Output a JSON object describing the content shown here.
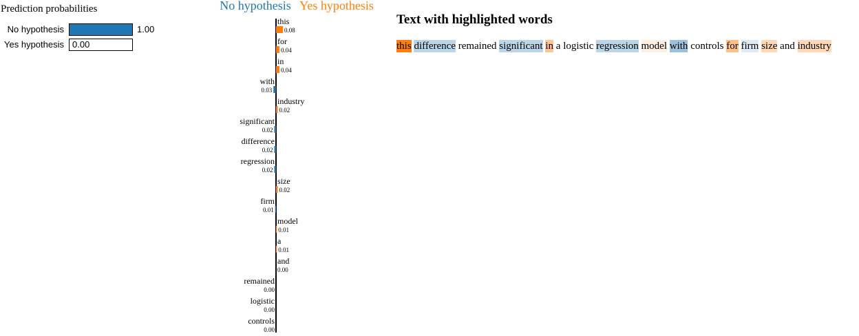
{
  "prediction": {
    "title": "Prediction probabilities",
    "classes": [
      {
        "label": "No hypothesis",
        "value": 1.0,
        "text": "1.00",
        "color": "#1f77b4"
      },
      {
        "label": "Yes hypothesis",
        "value": 0.0,
        "text": "0.00",
        "color": "#ff7f0e"
      }
    ]
  },
  "chart_data": {
    "type": "bar",
    "orientation": "horizontal",
    "negative_class": "No hypothesis",
    "positive_class": "Yes hypothesis",
    "negative_color": "#1f77b4",
    "positive_color": "#ff7f0e",
    "features": [
      {
        "word": "this",
        "weight": 0.08,
        "label": "0.08",
        "class": "Yes hypothesis"
      },
      {
        "word": "for",
        "weight": 0.04,
        "label": "0.04",
        "class": "Yes hypothesis"
      },
      {
        "word": "in",
        "weight": 0.04,
        "label": "0.04",
        "class": "Yes hypothesis"
      },
      {
        "word": "with",
        "weight": 0.03,
        "label": "0.03",
        "class": "No hypothesis"
      },
      {
        "word": "industry",
        "weight": 0.02,
        "label": "0.02",
        "class": "Yes hypothesis"
      },
      {
        "word": "significant",
        "weight": 0.02,
        "label": "0.02",
        "class": "No hypothesis"
      },
      {
        "word": "difference",
        "weight": 0.02,
        "label": "0.02",
        "class": "No hypothesis"
      },
      {
        "word": "regression",
        "weight": 0.02,
        "label": "0.02",
        "class": "No hypothesis"
      },
      {
        "word": "size",
        "weight": 0.02,
        "label": "0.02",
        "class": "Yes hypothesis"
      },
      {
        "word": "firm",
        "weight": 0.01,
        "label": "0.01",
        "class": "No hypothesis"
      },
      {
        "word": "model",
        "weight": 0.01,
        "label": "0.01",
        "class": "Yes hypothesis"
      },
      {
        "word": "a",
        "weight": 0.01,
        "label": "0.01",
        "class": "Yes hypothesis"
      },
      {
        "word": "and",
        "weight": 0.0,
        "label": "0.00",
        "class": "Yes hypothesis"
      },
      {
        "word": "remained",
        "weight": 0.0,
        "label": "0.00",
        "class": "No hypothesis"
      },
      {
        "word": "logistic",
        "weight": 0.0,
        "label": "0.00",
        "class": "No hypothesis"
      },
      {
        "word": "controls",
        "weight": 0.0,
        "label": "0.00",
        "class": "No hypothesis"
      }
    ]
  },
  "highlight": {
    "title": "Text with highlighted words",
    "words": [
      {
        "text": "this",
        "class": "Yes hypothesis",
        "strength": 1.0
      },
      {
        "text": "difference",
        "class": "No hypothesis",
        "strength": 0.3
      },
      {
        "text": "remained",
        "class": "none",
        "strength": 0
      },
      {
        "text": "significant",
        "class": "No hypothesis",
        "strength": 0.3
      },
      {
        "text": "in",
        "class": "Yes hypothesis",
        "strength": 0.45
      },
      {
        "text": "a",
        "class": "none",
        "strength": 0
      },
      {
        "text": "logistic",
        "class": "none",
        "strength": 0
      },
      {
        "text": "regression",
        "class": "No hypothesis",
        "strength": 0.3
      },
      {
        "text": "model",
        "class": "Yes hypothesis",
        "strength": 0.12
      },
      {
        "text": "with",
        "class": "No hypothesis",
        "strength": 0.45
      },
      {
        "text": "controls",
        "class": "none",
        "strength": 0
      },
      {
        "text": "for",
        "class": "Yes hypothesis",
        "strength": 0.5
      },
      {
        "text": "firm",
        "class": "No hypothesis",
        "strength": 0.15
      },
      {
        "text": "size",
        "class": "Yes hypothesis",
        "strength": 0.3
      },
      {
        "text": "and",
        "class": "none",
        "strength": 0
      },
      {
        "text": "industry",
        "class": "Yes hypothesis",
        "strength": 0.3
      }
    ]
  }
}
